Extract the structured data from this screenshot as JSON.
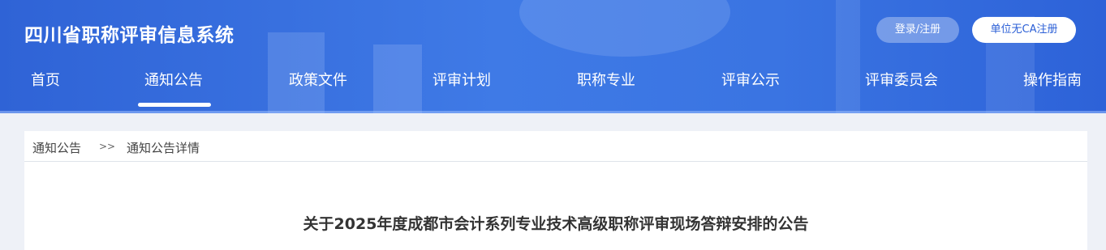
{
  "header": {
    "site_title": "四川省职称评审信息系统",
    "login_button": "登录/注册",
    "ca_button": "单位无CA注册",
    "accent_color": "#3a74e2"
  },
  "nav": {
    "items": [
      {
        "label": "首页"
      },
      {
        "label": "通知公告",
        "active": true
      },
      {
        "label": "政策文件"
      },
      {
        "label": "评审计划"
      },
      {
        "label": "职称专业"
      },
      {
        "label": "评审公示"
      },
      {
        "label": "评审委员会"
      },
      {
        "label": "操作指南"
      }
    ]
  },
  "breadcrumb": {
    "root": "通知公告",
    "separator": ">>",
    "current": "通知公告详情"
  },
  "article": {
    "title": "关于2025年度成都市会计系列专业技术高级职称评审现场答辩安排的公告"
  }
}
